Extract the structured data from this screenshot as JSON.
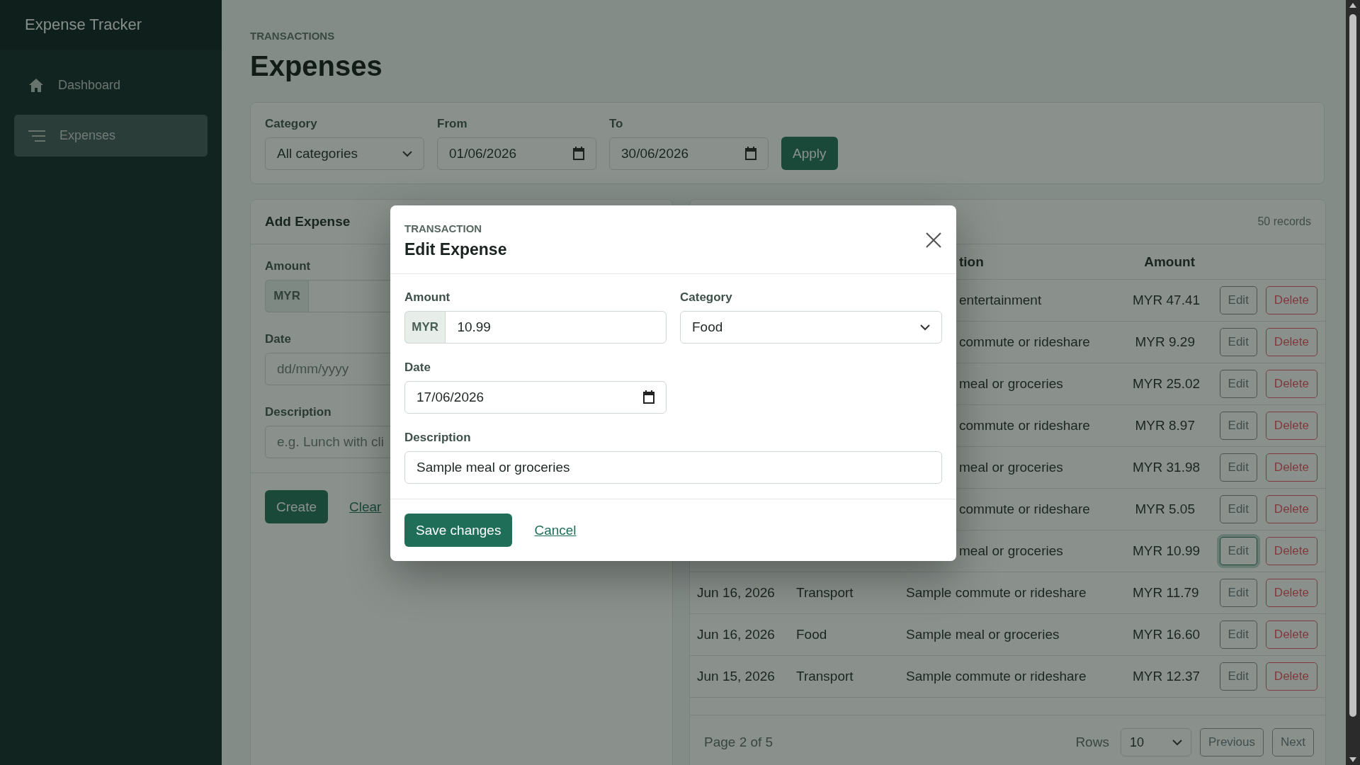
{
  "app": {
    "title": "Expense Tracker"
  },
  "sidebar": {
    "items": [
      {
        "label": "Dashboard",
        "selected": false
      },
      {
        "label": "Expenses",
        "selected": true
      }
    ]
  },
  "page": {
    "eyebrow": "TRANSACTIONS",
    "title": "Expenses"
  },
  "filters": {
    "fields": [
      {
        "label": "Category",
        "kind": "select",
        "value": "All categories"
      },
      {
        "label": "From",
        "kind": "date",
        "value": "01/06/2026"
      },
      {
        "label": "To",
        "kind": "date",
        "value": "30/06/2026"
      }
    ],
    "apply_button": "Apply"
  },
  "add_expense": {
    "title": "Add Expense",
    "fields": [
      {
        "label": "Amount",
        "kind": "amount",
        "prefix": "MYR"
      },
      {
        "label": "Date",
        "kind": "date",
        "placeholder": "dd/mm/yyyy"
      },
      {
        "label": "Description",
        "kind": "text",
        "placeholder": "e.g. Lunch with cli"
      }
    ],
    "create_button": "Create",
    "clear_link": "Clear"
  },
  "table": {
    "record_count": "50 records",
    "columns": [
      {
        "label": "tion"
      },
      {
        "label": "Amount"
      }
    ],
    "rows": [
      {
        "description": "entertainment",
        "amount": "MYR 47.41",
        "edit": "Edit",
        "delete": "Delete",
        "focused": false
      },
      {
        "description": "commute or rideshare",
        "amount": "MYR 9.29",
        "edit": "Edit",
        "delete": "Delete",
        "focused": false
      },
      {
        "description": "meal or groceries",
        "amount": "MYR 25.02",
        "edit": "Edit",
        "delete": "Delete",
        "focused": false
      },
      {
        "description": "commute or rideshare",
        "amount": "MYR 8.97",
        "edit": "Edit",
        "delete": "Delete",
        "focused": false
      },
      {
        "description": "meal or groceries",
        "amount": "MYR 31.98",
        "edit": "Edit",
        "delete": "Delete",
        "focused": false
      },
      {
        "description": "commute or rideshare",
        "amount": "MYR 5.05",
        "edit": "Edit",
        "delete": "Delete",
        "focused": false
      },
      {
        "description": "meal or groceries",
        "amount": "MYR 10.99",
        "edit": "Edit",
        "delete": "Delete",
        "focused": true
      },
      {
        "date": "Jun 16, 2026",
        "category": "Transport",
        "description": "Sample commute or rideshare",
        "amount": "MYR 11.79",
        "edit": "Edit",
        "delete": "Delete",
        "focused": false
      },
      {
        "date": "Jun 16, 2026",
        "category": "Food",
        "description": "Sample meal or groceries",
        "amount": "MYR 16.60",
        "edit": "Edit",
        "delete": "Delete",
        "focused": false
      },
      {
        "date": "Jun 15, 2026",
        "category": "Transport",
        "description": "Sample commute or rideshare",
        "amount": "MYR 12.37",
        "edit": "Edit",
        "delete": "Delete",
        "focused": false
      }
    ],
    "pagination": {
      "page_label": "Page 2 of 5",
      "rows_label": "Rows",
      "rows_value": "10",
      "previous": "Previous",
      "next": "Next"
    }
  },
  "modal": {
    "eyebrow": "TRANSACTION",
    "title": "Edit Expense",
    "fields": [
      {
        "label": "Amount",
        "kind": "amount",
        "prefix": "MYR",
        "value": "10.99"
      },
      {
        "label": "Category",
        "kind": "select",
        "value": "Food"
      },
      {
        "label": "Date",
        "kind": "date",
        "value": "17/06/2026"
      },
      {
        "label": "Description",
        "kind": "text",
        "value": "Sample meal or groceries"
      }
    ],
    "save_button": "Save changes",
    "cancel_link": "Cancel"
  }
}
